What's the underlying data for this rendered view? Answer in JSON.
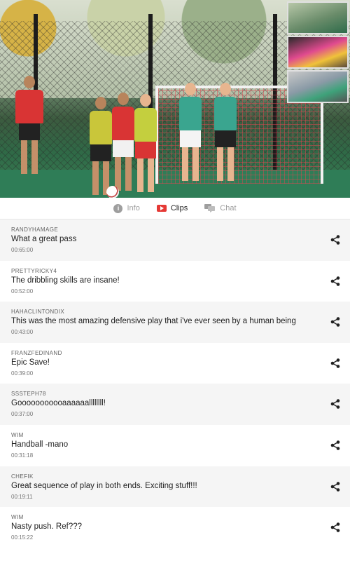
{
  "video": {
    "thumbnails": [
      "thumb-1",
      "thumb-2",
      "thumb-3"
    ]
  },
  "tabs": [
    {
      "label": "Info",
      "icon": "info-icon",
      "active": false
    },
    {
      "label": "Clips",
      "icon": "clips-icon",
      "active": true
    },
    {
      "label": "Chat",
      "icon": "chat-icon",
      "active": false
    }
  ],
  "clips": [
    {
      "user": "RANDYHAMAGE",
      "message": "What a great pass",
      "time": "00:65:00"
    },
    {
      "user": "PRETTYRICKY4",
      "message": "The dribbling skills are insane!",
      "time": "00:52:00"
    },
    {
      "user": "HAHACLINTONDIX",
      "message": "This was the most amazing defensive play that i've ever seen by a human being",
      "time": "00:43:00"
    },
    {
      "user": "FRANZFEDINAND",
      "message": "Epic Save!",
      "time": "00:39:00"
    },
    {
      "user": "SSSTEPH78",
      "message": "Gooooooooooaaaaaallllllll!",
      "time": "00:37:00"
    },
    {
      "user": "WIM",
      "message": "Handball -mano",
      "time": "00:31:18"
    },
    {
      "user": "CHEFIK",
      "message": "Great sequence of play in both ends. Exciting stuff!!!",
      "time": "00:19:11"
    },
    {
      "user": "WIM",
      "message": "Nasty push. Ref???",
      "time": "00:15:22"
    }
  ],
  "colors": {
    "accent_red": "#e53935",
    "row_shade": "#f5f5f5"
  }
}
